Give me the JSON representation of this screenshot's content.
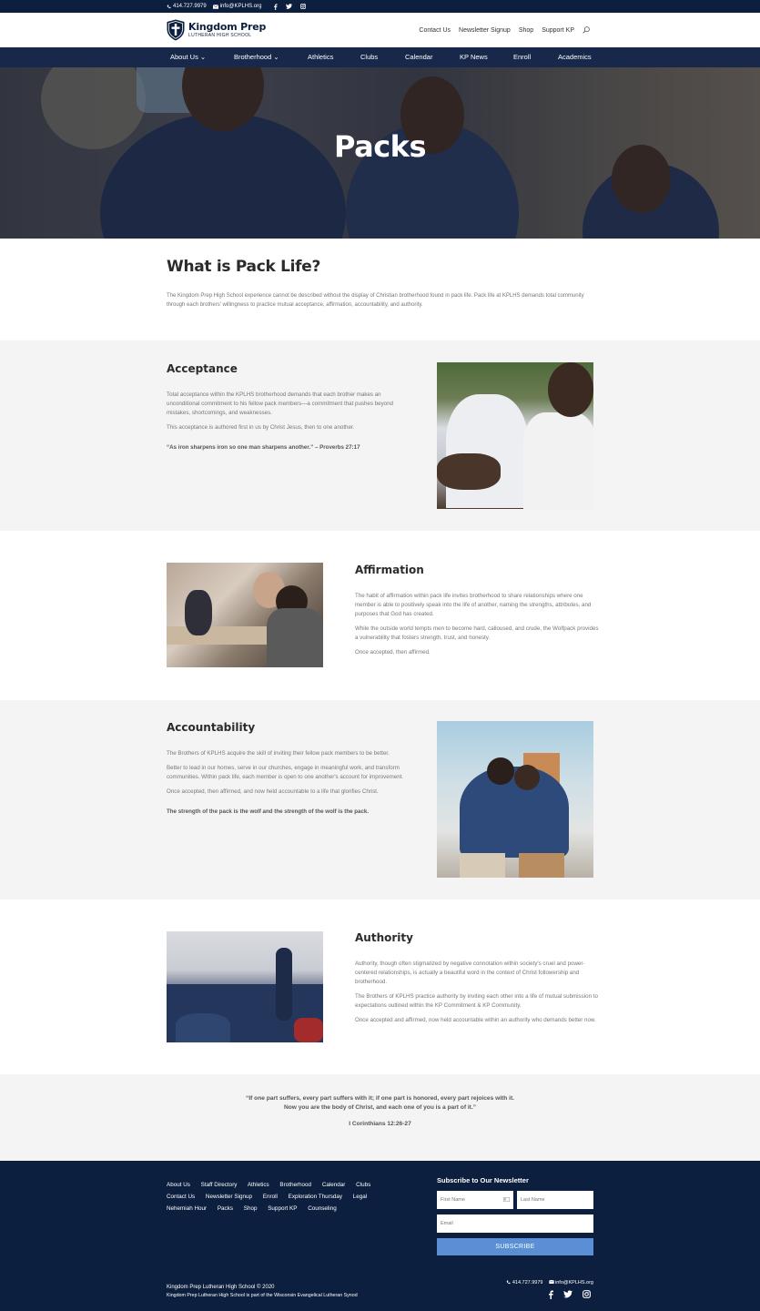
{
  "topbar": {
    "phone": "414.727.9979",
    "email": "info@KPLHS.org",
    "social": [
      "facebook-icon",
      "twitter-icon",
      "instagram-icon"
    ]
  },
  "header": {
    "logo_title": "Kingdom Prep",
    "logo_subtitle": "LUTHERAN HIGH SCHOOL",
    "links": [
      "Contact Us",
      "Newsletter Signup",
      "Shop",
      "Support KP"
    ]
  },
  "nav": {
    "items": [
      {
        "label": "About Us ⌄"
      },
      {
        "label": "Brotherhood ⌄"
      },
      {
        "label": "Athletics"
      },
      {
        "label": "Clubs"
      },
      {
        "label": "Calendar"
      },
      {
        "label": "KP News"
      },
      {
        "label": "Enroll"
      },
      {
        "label": "Academics"
      }
    ]
  },
  "hero": {
    "title": "Packs"
  },
  "intro": {
    "heading": "What is Pack Life?",
    "text": "The Kingdom Prep High School experience cannot be described without the display of Christian brotherhood found in pack life. Pack life at KPLHS demands total community through each brothers' willingness to practice mutual acceptance, affirmation, accountability, and authority."
  },
  "sections": {
    "acceptance": {
      "heading": "Acceptance",
      "p1": "Total acceptance within the KPLHS brotherhood demands that each brother makes an unconditional commitment to his fellow pack members—a commitment that pushes beyond mistakes, shortcomings, and weaknesses.",
      "p2": "This acceptance is authored first in us by Christ Jesus, then to one another.",
      "quote": "“As iron sharpens iron so one man sharpens another.” – Proverbs 27:17"
    },
    "affirmation": {
      "heading": "Affirmation",
      "p1": "The habit of affirmation within pack life invites brotherhood to share relationships where one member is able to positively speak into the life of another, naming the strengths, attributes, and purposes that God has created.",
      "p2": "While the outside world tempts men to become hard, calloused, and crude, the Wolfpack provides a vulnerability that fosters strength, trust, and honesty.",
      "p3": "Once accepted, then affirmed."
    },
    "accountability": {
      "heading": "Accountability",
      "p1": "The Brothers of KPLHS acquire the skill of inviting their fellow pack members to be better.",
      "p2": "Better to lead in our homes, serve in our churches, engage in meaningful work, and transform communities. Within pack life, each member is open to one another's account for improvement.",
      "p3": "Once accepted, then affirmed, and now held accountable to a life that glorifies Christ.",
      "quote": "The strength of the pack is the wolf and the strength of the wolf is the pack."
    },
    "authority": {
      "heading": "Authority",
      "p1": "Authority, though often stigmatized by negative connotation within society's cruel and power-centered relationships, is actually a beautiful word in the context of Christ followership and brotherhood.",
      "p2": "The Brothers of KPLHS practice authority by inviting each other into a life of mutual submission to expectations outlined within the KP Commitment & KP Community.",
      "p3": "Once accepted and affirmed, now held accountable within an authority who demands better now."
    }
  },
  "scripture": {
    "line1": "“If one part suffers, every part suffers with it; if one part is honored, every part rejoices with it.",
    "line2": "Now you are the body of Christ, and each one of you is a part of it.”",
    "ref": "I Corinthians 12:26-27"
  },
  "footer": {
    "links_row1": [
      "About Us",
      "Staff Directory",
      "Athletics",
      "Brotherhood",
      "Calendar",
      "Clubs"
    ],
    "links_row2": [
      "Contact Us",
      "Newsletter Signup",
      "Enroll",
      "Exploration Thursday",
      "Legal"
    ],
    "links_row3": [
      "Nehemiah Hour",
      "Packs",
      "Shop",
      "Support KP",
      "Counseling"
    ],
    "newsletter_heading": "Subscribe to Our Newsletter",
    "first_name_placeholder": "First Name",
    "last_name_placeholder": "Last Name",
    "email_placeholder": "Email",
    "subscribe_label": "SUBSCRIBE",
    "copyright": "Kingdom Prep Lutheran High School © 2020",
    "synod_note": "Kingdom Prep Lutheran High School is part of the Wisconsin Evangelical Lutheran Synod",
    "phone": "414.727.9979",
    "email": "info@KPLHS.org",
    "social": [
      "facebook-icon",
      "twitter-icon",
      "instagram-icon"
    ]
  },
  "colors": {
    "navy": "#0c1f3f",
    "nav_bar": "#17284b",
    "section_grey": "#f4f4f4",
    "subscribe_blue": "#5a8fd6"
  }
}
